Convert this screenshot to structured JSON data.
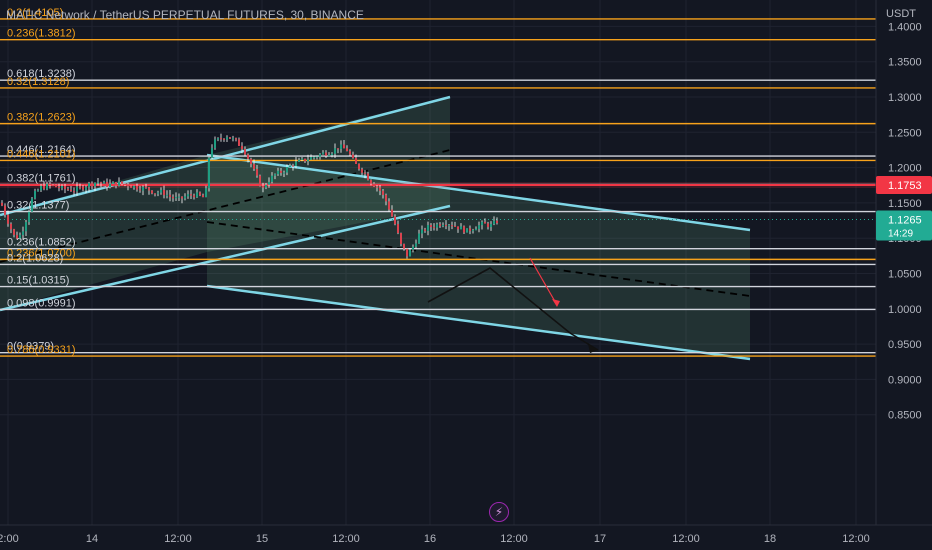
{
  "symbol_title": "MATIC Network / TetherUS PERPETUAL FUTURES, 30, BINANCE",
  "currency": "USDT",
  "colors": {
    "bg": "#131722",
    "grid": "#1f2330",
    "orange": "#f7a21b",
    "white": "#d1d4dc",
    "cyan": "#7fd6e6",
    "red": "#f23645",
    "green": "#22ab94"
  },
  "price_scale": {
    "ticks": [
      "1.4000",
      "1.3500",
      "1.3000",
      "1.2500",
      "1.2000",
      "1.1500",
      "1.1000",
      "1.0500",
      "1.0000",
      "0.9500",
      "0.9000",
      "0.8500"
    ],
    "price_badge": {
      "value": "1.1265",
      "countdown": "14:29"
    },
    "level_badge": "1.1753"
  },
  "time_axis": [
    "2:00",
    "14",
    "12:00",
    "15",
    "12:00",
    "16",
    "12:00",
    "17",
    "12:00",
    "18",
    "12:00"
  ],
  "fib_levels": [
    {
      "label": "0.2(1.4105)",
      "price": 1.4105,
      "color": "orange"
    },
    {
      "label": "0.236(1.3812)",
      "price": 1.3812,
      "color": "orange"
    },
    {
      "label": "0.618(1.3238)",
      "price": 1.3238,
      "color": "white"
    },
    {
      "label": "0.32(1.3128)",
      "price": 1.3128,
      "color": "orange"
    },
    {
      "label": "0.382(1.2623)",
      "price": 1.2623,
      "color": "orange"
    },
    {
      "label": "0.446(1.2164)",
      "price": 1.2164,
      "color": "white"
    },
    {
      "label": "0.446(1.2101)",
      "price": 1.2101,
      "color": "orange"
    },
    {
      "label": "0.382(1.1761)",
      "price": 1.1761,
      "color": "white"
    },
    {
      "label": "0.32(1.1377)",
      "price": 1.1377,
      "color": "white"
    },
    {
      "label": "0.236(1.0852)",
      "price": 1.0852,
      "color": "white"
    },
    {
      "label": "0.236(1.0700)",
      "price": 1.07,
      "color": "orange"
    },
    {
      "label": "0.2(1.0628)",
      "price": 1.0628,
      "color": "white"
    },
    {
      "label": "0.15(1.0315)",
      "price": 1.0315,
      "color": "white"
    },
    {
      "label": "0.098(0.9991)",
      "price": 0.9991,
      "color": "white"
    },
    {
      "label": "0(0.9379)",
      "price": 0.9379,
      "color": "white"
    },
    {
      "label": "0.786(0.9331)",
      "price": 0.9331,
      "color": "orange"
    }
  ],
  "chart_data": {
    "type": "candlestick",
    "y_range": [
      0.84,
      1.42
    ],
    "price_path": [
      [
        0,
        1.15
      ],
      [
        4,
        1.135
      ],
      [
        8,
        1.12
      ],
      [
        14,
        1.1
      ],
      [
        20,
        1.105
      ],
      [
        26,
        1.13
      ],
      [
        32,
        1.16
      ],
      [
        40,
        1.172
      ],
      [
        50,
        1.175
      ],
      [
        62,
        1.17
      ],
      [
        74,
        1.168
      ],
      [
        86,
        1.175
      ],
      [
        96,
        1.18
      ],
      [
        106,
        1.175
      ],
      [
        116,
        1.178
      ],
      [
        126,
        1.176
      ],
      [
        136,
        1.172
      ],
      [
        146,
        1.17
      ],
      [
        154,
        1.165
      ],
      [
        162,
        1.165
      ],
      [
        170,
        1.158
      ],
      [
        178,
        1.155
      ],
      [
        186,
        1.16
      ],
      [
        194,
        1.162
      ],
      [
        202,
        1.158
      ],
      [
        206,
        1.17
      ],
      [
        208,
        1.215
      ],
      [
        212,
        1.235
      ],
      [
        218,
        1.24
      ],
      [
        226,
        1.245
      ],
      [
        234,
        1.238
      ],
      [
        242,
        1.228
      ],
      [
        250,
        1.205
      ],
      [
        256,
        1.185
      ],
      [
        262,
        1.17
      ],
      [
        266,
        1.18
      ],
      [
        274,
        1.19
      ],
      [
        282,
        1.195
      ],
      [
        292,
        1.205
      ],
      [
        302,
        1.21
      ],
      [
        312,
        1.215
      ],
      [
        322,
        1.22
      ],
      [
        330,
        1.222
      ],
      [
        338,
        1.23
      ],
      [
        346,
        1.225
      ],
      [
        354,
        1.205
      ],
      [
        362,
        1.195
      ],
      [
        370,
        1.18
      ],
      [
        378,
        1.17
      ],
      [
        386,
        1.15
      ],
      [
        394,
        1.12
      ],
      [
        400,
        1.09
      ],
      [
        406,
        1.076
      ],
      [
        412,
        1.088
      ],
      [
        418,
        1.105
      ],
      [
        426,
        1.115
      ],
      [
        434,
        1.118
      ],
      [
        442,
        1.122
      ],
      [
        450,
        1.12
      ],
      [
        458,
        1.115
      ],
      [
        466,
        1.11
      ],
      [
        474,
        1.116
      ],
      [
        482,
        1.12
      ],
      [
        490,
        1.118
      ],
      [
        498,
        1.126
      ]
    ]
  }
}
